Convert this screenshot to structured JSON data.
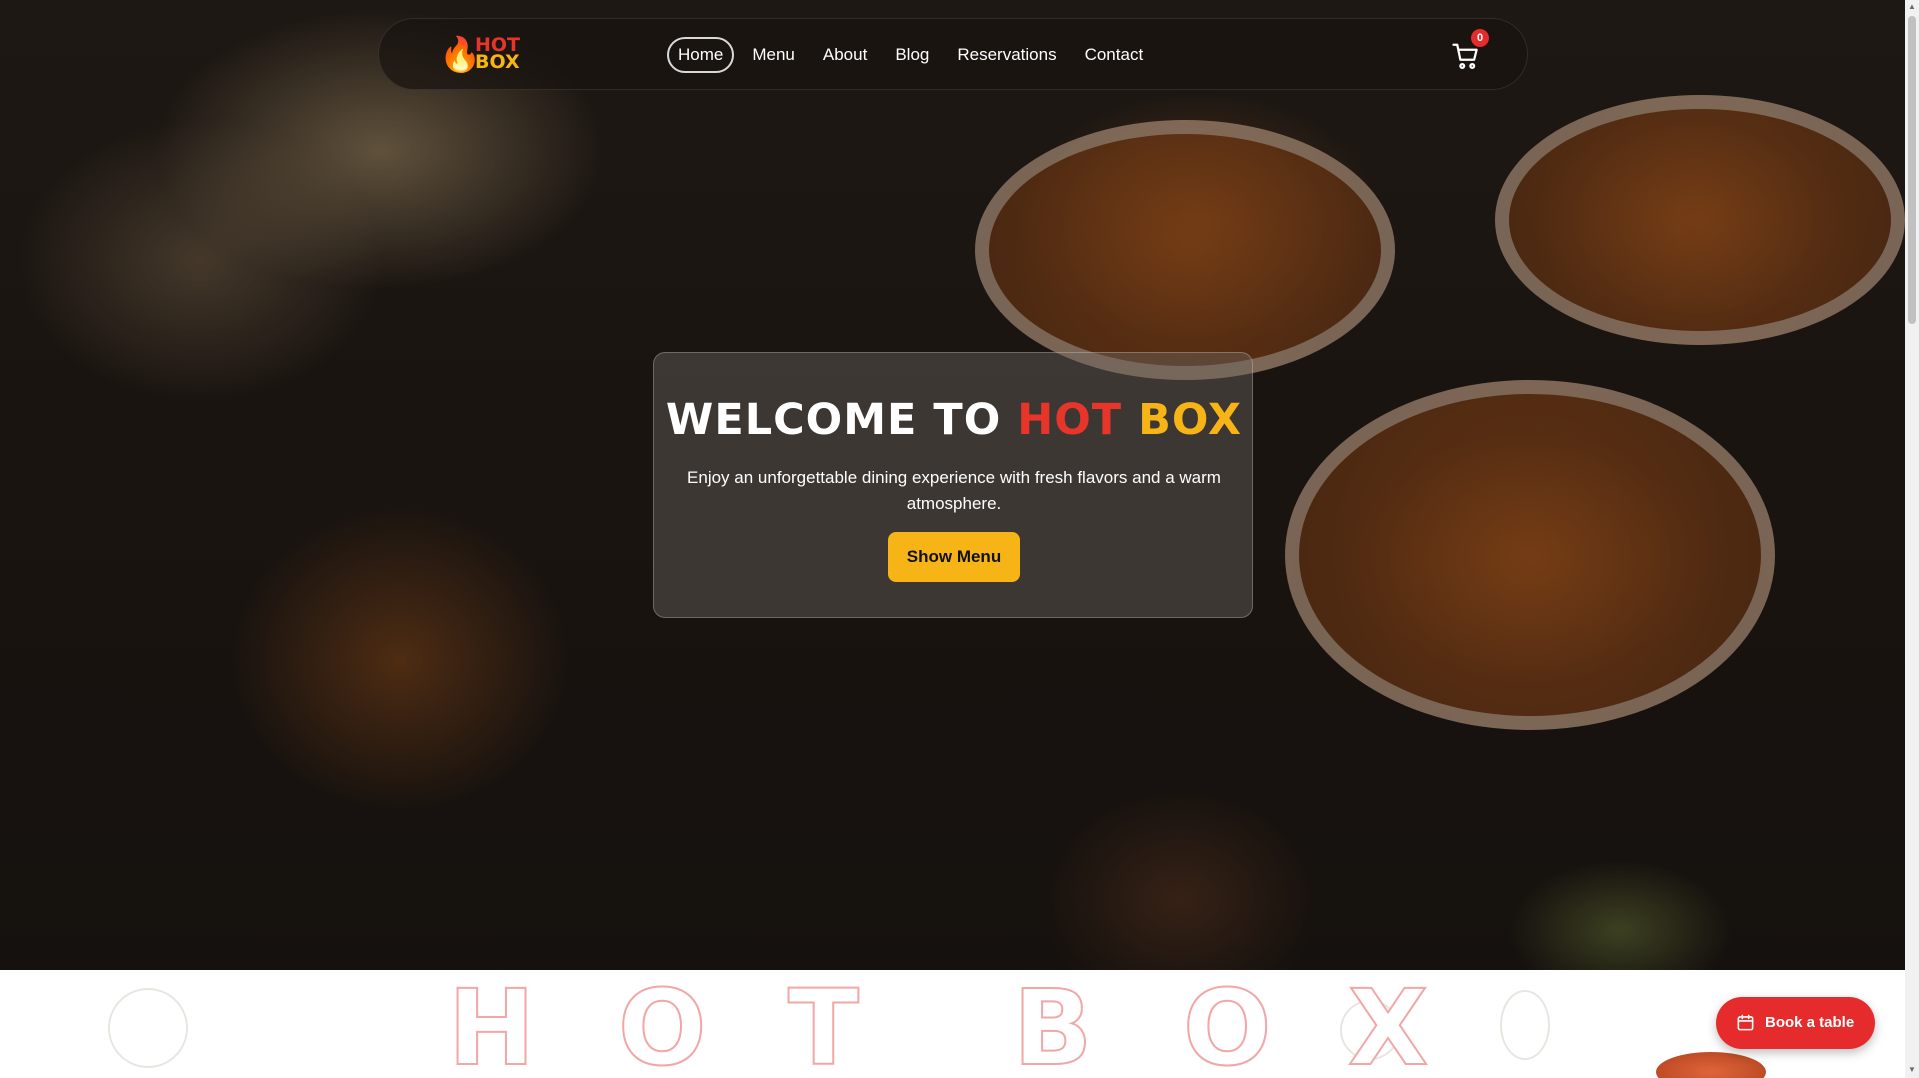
{
  "nav": {
    "logo": {
      "line1": "HOT",
      "line2": "BOX"
    },
    "links": [
      "Home",
      "Menu",
      "About",
      "Blog",
      "Reservations",
      "Contact"
    ],
    "active": "Home",
    "cart_count": "0"
  },
  "hero": {
    "title_prefix": "WELCOME TO",
    "title_hot": "HOT",
    "title_box": "BOX",
    "subtitle": "Enjoy an unforgettable dining experience with fresh flavors and a warm atmosphere.",
    "cta_label": "Show Menu"
  },
  "strip": {
    "letters": [
      "H",
      "O",
      "T",
      "B",
      "O",
      "X"
    ]
  },
  "book_button": {
    "label": "Book a table"
  },
  "colors": {
    "red": "#e52b2b",
    "yellow": "#f7b417",
    "logo_red": "#e8352a"
  },
  "icons": [
    "flame-icon",
    "cart-icon",
    "calendar-icon"
  ]
}
